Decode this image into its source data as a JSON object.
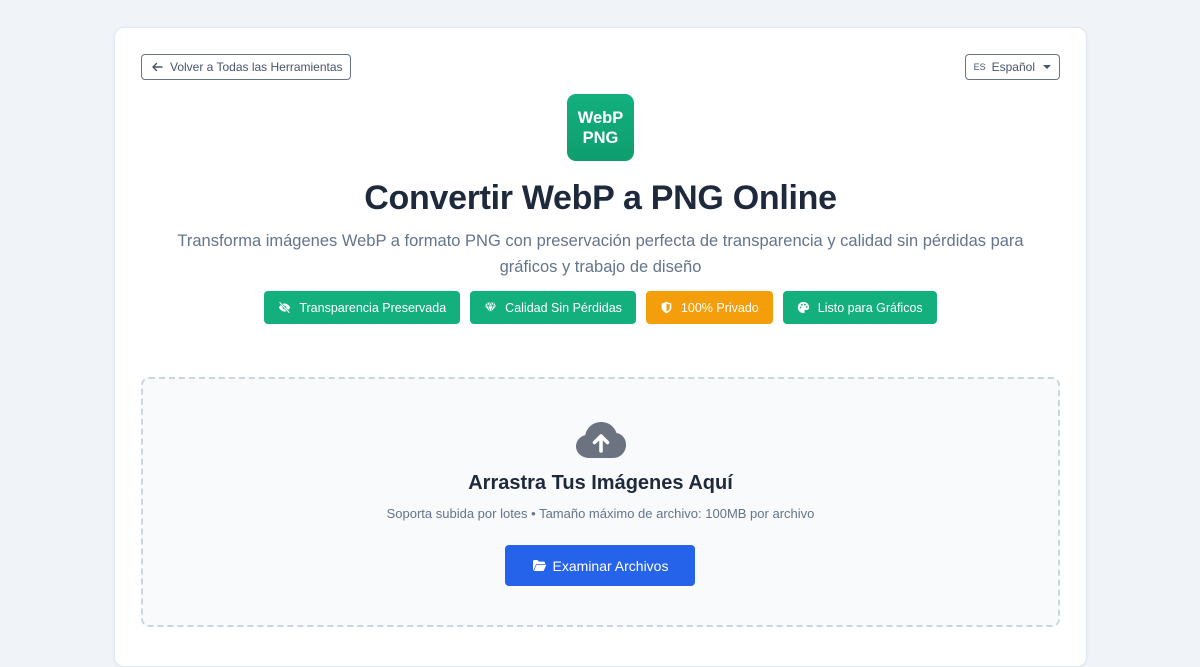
{
  "header": {
    "back_label": "Volver a Todas las Herramientas",
    "lang_code": "ES",
    "lang_label": "Español"
  },
  "logo": {
    "line1": "WebP",
    "line2": "PNG"
  },
  "hero": {
    "title": "Convertir WebP a PNG Online",
    "subtitle": "Transforma imágenes WebP a formato PNG con preservación perfecta de transparencia y calidad sin pérdidas para gráficos y trabajo de diseño"
  },
  "badges": [
    {
      "label": "Transparencia Preservada",
      "icon": "eye-slash-icon",
      "color": "#13b07e"
    },
    {
      "label": "Calidad Sin Pérdidas",
      "icon": "gem-icon",
      "color": "#13b07e"
    },
    {
      "label": "100% Privado",
      "icon": "shield-icon",
      "color": "#f59e0b"
    },
    {
      "label": "Listo para Gráficos",
      "icon": "palette-icon",
      "color": "#13b07e"
    }
  ],
  "upload": {
    "icon": "cloud-upload-icon",
    "title": "Arrastra Tus Imágenes Aquí",
    "subtitle": "Soporta subida por lotes • Tamaño máximo de archivo: 100MB por archivo",
    "button_label": "Examinar Archivos",
    "button_icon": "folder-open-icon"
  },
  "colors": {
    "accent_green": "#13b07e",
    "accent_amber": "#f59e0b",
    "primary_blue": "#2563eb",
    "background": "#f0f3f8"
  }
}
